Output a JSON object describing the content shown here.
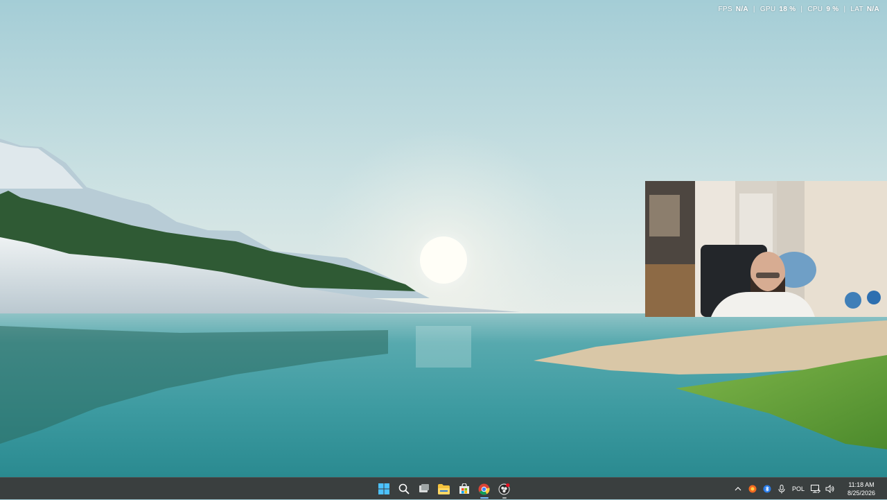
{
  "overlay": {
    "fps_label": "FPS",
    "fps_value": "N/A",
    "gpu_label": "GPU",
    "gpu_value": "18 %",
    "cpu_label": "CPU",
    "cpu_value": "9 %",
    "lat_label": "LAT",
    "lat_value": "N/A",
    "separator": "|"
  },
  "taskbar": {
    "pinned": [
      {
        "name": "start",
        "icon": "windows-logo-icon",
        "active": false
      },
      {
        "name": "search",
        "icon": "search-icon",
        "active": false
      },
      {
        "name": "task-view",
        "icon": "task-view-icon",
        "active": false
      },
      {
        "name": "file-explorer",
        "icon": "folder-icon",
        "active": false
      },
      {
        "name": "microsoft-store",
        "icon": "store-icon",
        "active": false
      },
      {
        "name": "chrome",
        "icon": "chrome-icon",
        "active": true
      },
      {
        "name": "obs",
        "icon": "obs-recording-icon",
        "active": false
      }
    ],
    "tray": {
      "language": "POL",
      "time": "11:18 AM",
      "date": "8/25/2026"
    }
  },
  "colors": {
    "taskbar_bg": "#3a3f3f",
    "active_indicator": "#78c0ff",
    "sky_top": "#a9d0d8",
    "water": "#3f9ea3"
  }
}
